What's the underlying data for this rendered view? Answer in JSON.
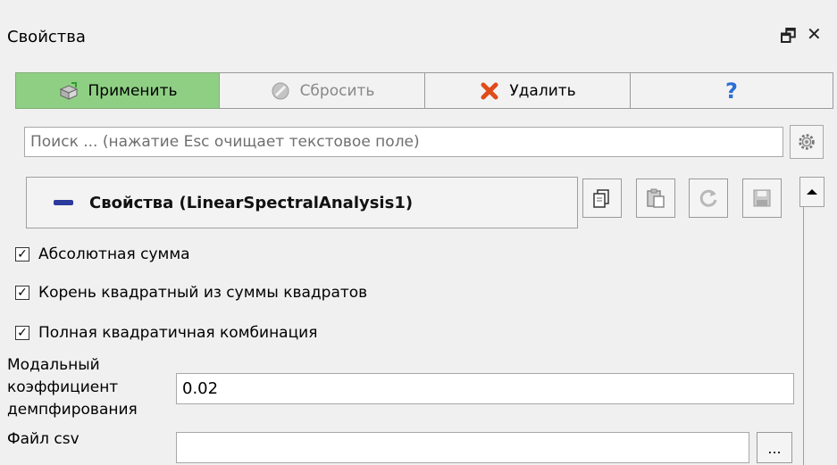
{
  "panel": {
    "title": "Свойства",
    "float_glyph": "🗗",
    "close_glyph": "✕"
  },
  "toolbar": {
    "apply_label": "Применить",
    "reset_label": "Сбросить",
    "delete_label": "Удалить",
    "help_glyph": "?"
  },
  "search": {
    "placeholder": "Поиск ... (нажатие Esc очищает текстовое поле)"
  },
  "section": {
    "title": "Свойства (LinearSpectralAnalysis1)",
    "icons": [
      "copy-icon",
      "paste-icon",
      "refresh-icon",
      "save-icon"
    ]
  },
  "options": [
    {
      "label": "Абсолютная сумма",
      "checked": true
    },
    {
      "label": "Корень квадратный из суммы квадратов",
      "checked": true
    },
    {
      "label": "Полная квадратичная комбинация",
      "checked": true
    }
  ],
  "fields": {
    "damping_label_1": "Модальный",
    "damping_label_2": "коэффициент",
    "damping_label_3": "демпфирования",
    "damping_value": "0.02",
    "csv_label": "Файл csv",
    "csv_value": "",
    "browse_label": "..."
  },
  "colors": {
    "apply_bg": "#8fcf84",
    "collapse_bar": "#2b3a9c",
    "delete_icon": "#e04b1a",
    "help_icon": "#2a6fd6"
  }
}
